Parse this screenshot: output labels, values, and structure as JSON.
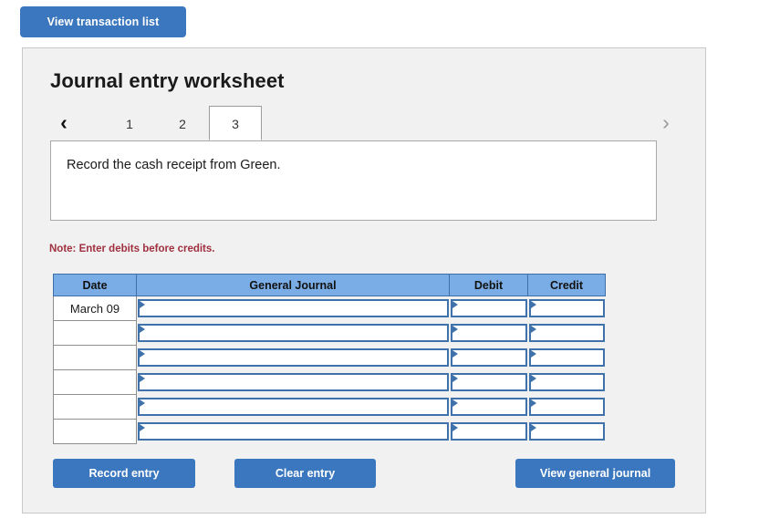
{
  "top_bar": {
    "view_transaction_list_label": "View transaction list"
  },
  "panel": {
    "title": "Journal entry worksheet",
    "tabs": {
      "prev_arrow": "‹",
      "next_arrow": "›",
      "items": [
        {
          "label": "1",
          "active": false
        },
        {
          "label": "2",
          "active": false
        },
        {
          "label": "3",
          "active": true
        }
      ]
    },
    "instruction": "Record the cash receipt from Green.",
    "note": "Note: Enter debits before credits.",
    "note_color": "#a03040",
    "table": {
      "headers": [
        "Date",
        "General Journal",
        "Debit",
        "Credit"
      ],
      "header_bg": "#7aade5",
      "rows": [
        {
          "date": "March 09",
          "general_journal": "",
          "debit": "",
          "credit": ""
        },
        {
          "date": "",
          "general_journal": "",
          "debit": "",
          "credit": ""
        },
        {
          "date": "",
          "general_journal": "",
          "debit": "",
          "credit": ""
        },
        {
          "date": "",
          "general_journal": "",
          "debit": "",
          "credit": ""
        },
        {
          "date": "",
          "general_journal": "",
          "debit": "",
          "credit": ""
        },
        {
          "date": "",
          "general_journal": "",
          "debit": "",
          "credit": ""
        }
      ]
    },
    "buttons": {
      "record_entry": "Record entry",
      "clear_entry": "Clear entry",
      "view_general_journal": "View general journal",
      "accent_color": "#3b77be"
    }
  }
}
